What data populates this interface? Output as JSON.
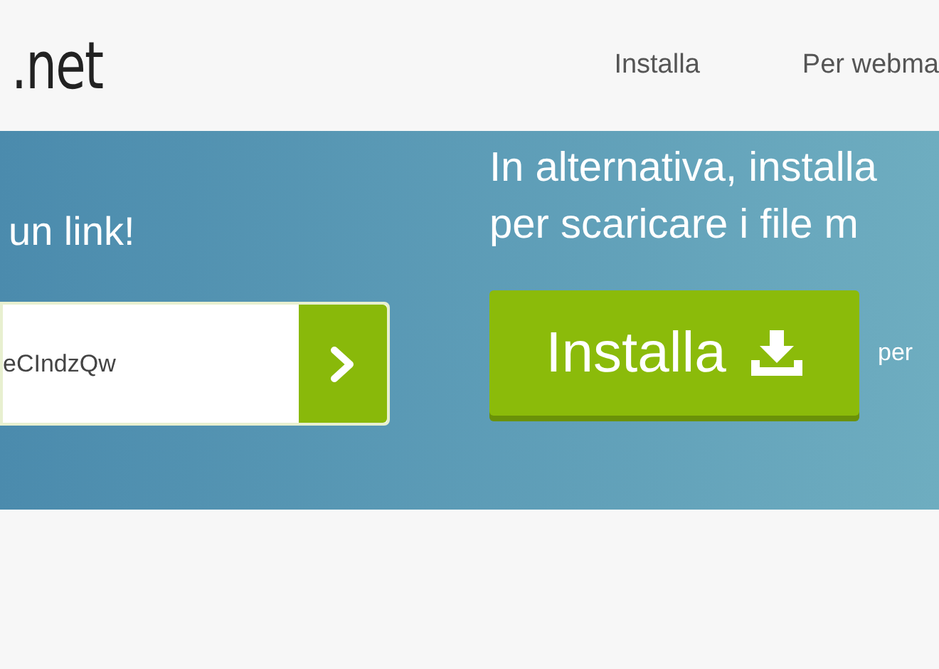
{
  "header": {
    "logo": ".net",
    "nav": [
      {
        "label": "Installa"
      },
      {
        "label": "Per webma"
      }
    ]
  },
  "banner": {
    "left_heading": "un link!",
    "url_field": {
      "value": "eCIndzQw"
    },
    "right_heading": [
      "In alternativa, installa",
      "per scaricare i file m"
    ],
    "install_button": {
      "label": "Installa"
    },
    "side_text": "per"
  }
}
